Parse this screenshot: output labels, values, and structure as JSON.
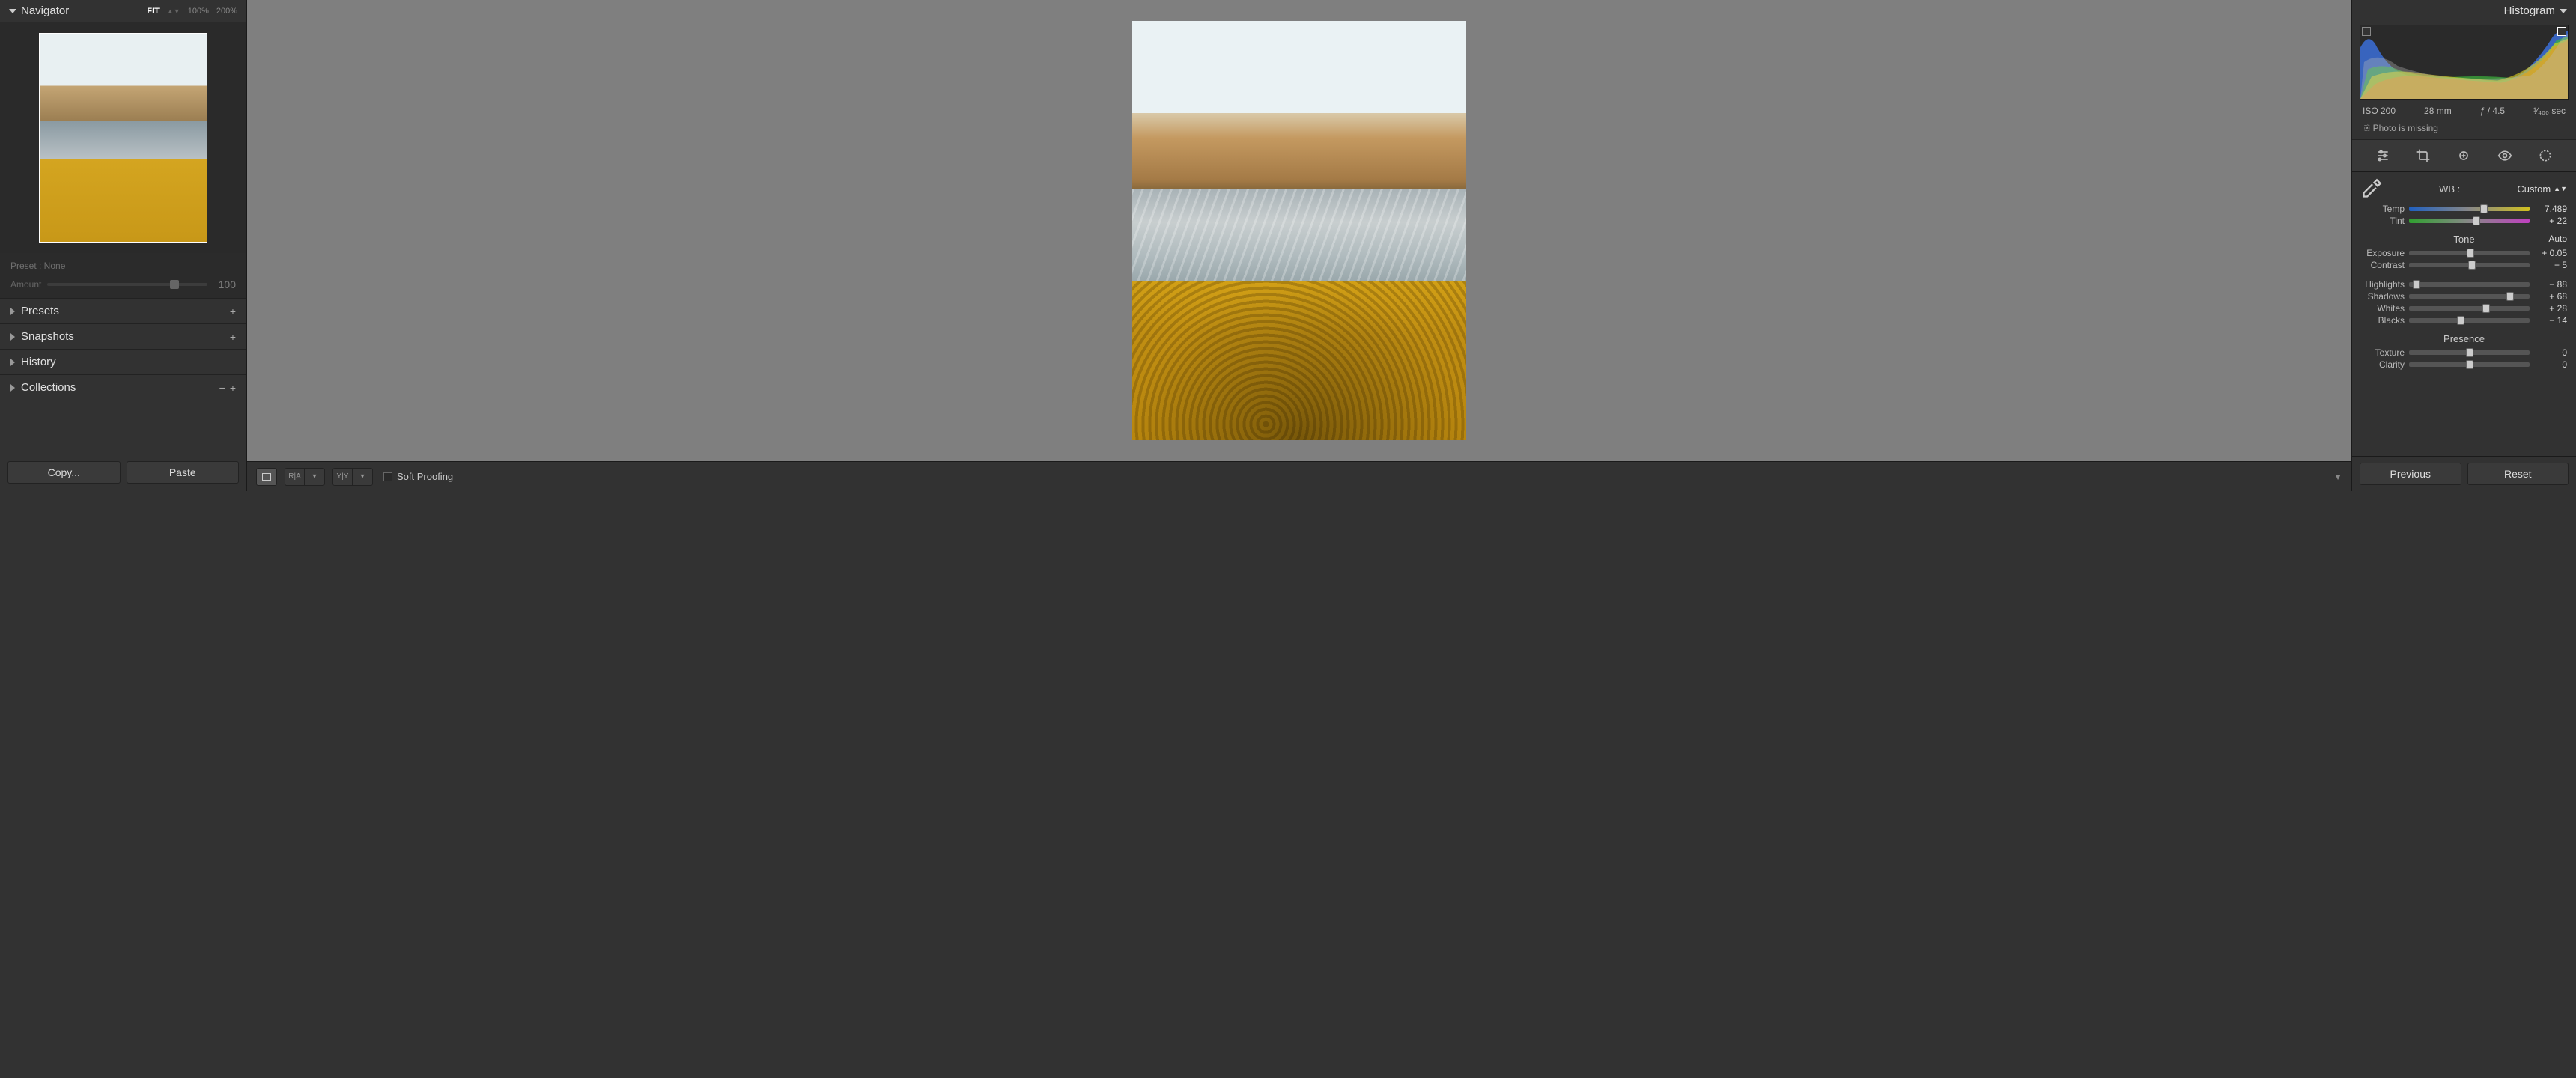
{
  "left": {
    "navigator": "Navigator",
    "zoom": {
      "fit": "FIT",
      "z100": "100%",
      "z200": "200%"
    },
    "preset_label": "Preset : None",
    "amount_label": "Amount",
    "amount_value": "100",
    "rows": {
      "presets": "Presets",
      "snapshots": "Snapshots",
      "history": "History",
      "collections": "Collections"
    },
    "copy": "Copy...",
    "paste": "Paste"
  },
  "center": {
    "soft_proofing": "Soft Proofing",
    "compare_ra": "R|A",
    "compare_yy": "Y|Y"
  },
  "right": {
    "histogram": "Histogram",
    "exif": {
      "iso": "ISO 200",
      "focal": "28 mm",
      "aperture": "ƒ / 4.5",
      "shutter": "¹⁄₄₀₀ sec"
    },
    "missing": "Photo is missing",
    "wb_label": "WB :",
    "wb_value": "Custom",
    "sliders": {
      "temp": {
        "label": "Temp",
        "value": "7,489"
      },
      "tint": {
        "label": "Tint",
        "value": "+ 22"
      },
      "exposure": {
        "label": "Exposure",
        "value": "+ 0.05"
      },
      "contrast": {
        "label": "Contrast",
        "value": "+ 5"
      },
      "highlights": {
        "label": "Highlights",
        "value": "− 88"
      },
      "shadows": {
        "label": "Shadows",
        "value": "+ 68"
      },
      "whites": {
        "label": "Whites",
        "value": "+ 28"
      },
      "blacks": {
        "label": "Blacks",
        "value": "− 14"
      },
      "texture": {
        "label": "Texture",
        "value": "0"
      },
      "clarity": {
        "label": "Clarity",
        "value": "0"
      }
    },
    "tone_title": "Tone",
    "auto": "Auto",
    "presence_title": "Presence",
    "previous": "Previous",
    "reset": "Reset"
  }
}
